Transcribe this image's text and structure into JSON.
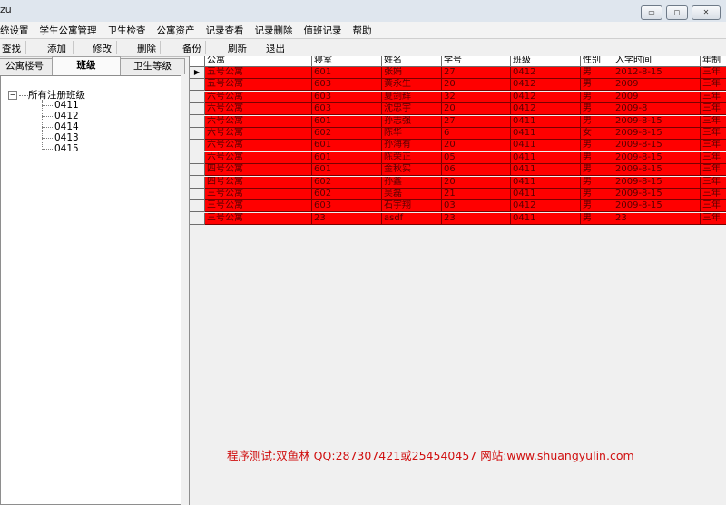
{
  "window": {
    "title_fragment": "zu",
    "buttons": [
      "▭",
      "◻",
      "✕"
    ]
  },
  "menubar": {
    "items": [
      "统设置",
      "学生公寓管理",
      "卫生检查",
      "公寓资产",
      "记录查看",
      "记录删除",
      "值班记录",
      "帮助"
    ]
  },
  "toolbar": {
    "buttons": [
      "查找",
      "添加",
      "修改",
      "删除",
      "备份",
      "刷新",
      "退出"
    ]
  },
  "tabs": [
    "公寓楼号",
    "班级",
    "卫生等级"
  ],
  "tree": {
    "root": "所有注册班级",
    "children": [
      "0411",
      "0412",
      "0414",
      "0413",
      "0415"
    ]
  },
  "grid": {
    "columns": [
      "公寓",
      "寝室",
      "姓名",
      "学号",
      "班级",
      "性别",
      "入学时间",
      "年制"
    ],
    "rows": [
      [
        "五号公寓",
        "601",
        "张娟",
        "27",
        "0412",
        "男",
        "2012-8-15",
        "三年"
      ],
      [
        "五号公寓",
        "603",
        "黄永生",
        "20",
        "0412",
        "男",
        "2009",
        "三年"
      ],
      [
        "六号公寓",
        "603",
        "夏剑辉",
        "32",
        "0412",
        "男",
        "2009",
        "三年"
      ],
      [
        "六号公寓",
        "603",
        "沈忠宇",
        "20",
        "0412",
        "男",
        "2009-8",
        "三年"
      ],
      [
        "六号公寓",
        "601",
        "孙志强",
        "27",
        "0411",
        "男",
        "2009-8-15",
        "三年"
      ],
      [
        "六号公寓",
        "602",
        "陈华",
        "6",
        "0411",
        "女",
        "2009-8-15",
        "三年"
      ],
      [
        "六号公寓",
        "601",
        "孙海有",
        "20",
        "0411",
        "男",
        "2009-8-15",
        "三年"
      ],
      [
        "六号公寓",
        "601",
        "陈荣正",
        "05",
        "0411",
        "男",
        "2009-8-15",
        "三年"
      ],
      [
        "四号公寓",
        "601",
        "金秋实",
        "06",
        "0411",
        "男",
        "2009-8-15",
        "三年"
      ],
      [
        "四号公寓",
        "602",
        "孙鑫",
        "20",
        "0411",
        "男",
        "2009-8-15",
        "三年"
      ],
      [
        "三号公寓",
        "602",
        "吴磊",
        "21",
        "0411",
        "男",
        "2009-8-15",
        "三年"
      ],
      [
        "三号公寓",
        "603",
        "石宇翔",
        "03",
        "0412",
        "男",
        "2009-8-15",
        "三年"
      ],
      [
        "三号公寓",
        "23",
        "asdf",
        "23",
        "0411",
        "男",
        "23",
        "三年"
      ]
    ],
    "row_color": "#ff0000",
    "current_row_marker": "▶"
  },
  "watermark": "程序测试:双鱼林 QQ:287307421或254540457 网站:www.shuangyulin.com"
}
